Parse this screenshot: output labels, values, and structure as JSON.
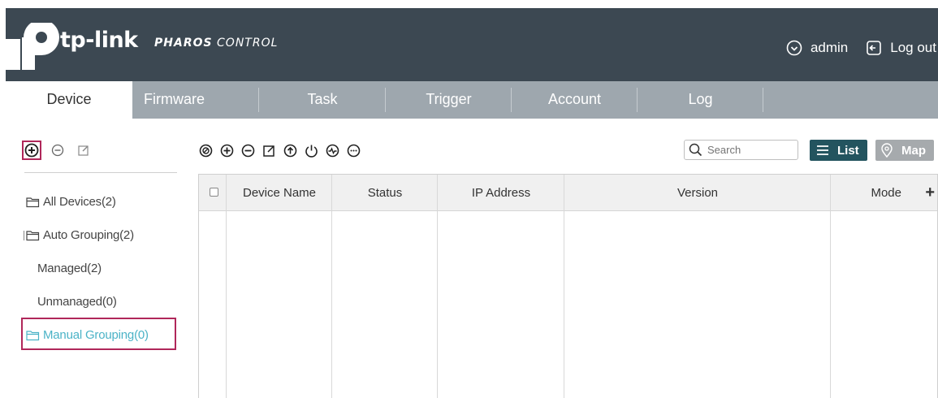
{
  "header": {
    "brand": "tp-link",
    "product_bold": "PHAROS",
    "product_light": "CONTROL",
    "user": "admin",
    "logout": "Log out",
    "colors": {
      "bar": "#3c4852",
      "tabs": "#9ea7ae",
      "accent": "#4bb3c7",
      "highlight": "#b0275a",
      "list_button": "#23545f"
    }
  },
  "tabs": [
    {
      "label": "Device",
      "active": true
    },
    {
      "label": "Firmware"
    },
    {
      "label": "Task"
    },
    {
      "label": "Trigger"
    },
    {
      "label": "Account"
    },
    {
      "label": "Log"
    }
  ],
  "left_tools": {
    "icons": [
      "add-group-icon",
      "remove-group-icon",
      "edit-group-icon"
    ]
  },
  "tree": {
    "all_devices": "All Devices(2)",
    "auto_grouping": "Auto Grouping(2)",
    "managed": "Managed(2)",
    "unmanaged": "Unmanaged(0)",
    "manual_grouping": "Manual Grouping(0)"
  },
  "toolbar": {
    "icons": [
      "adopt-icon",
      "add-icon",
      "remove-icon",
      "edit-icon",
      "upgrade-icon",
      "power-icon",
      "monitor-icon",
      "more-icon"
    ]
  },
  "search": {
    "placeholder": "Search"
  },
  "views": {
    "list": "List",
    "map": "Map"
  },
  "table": {
    "columns": [
      "Device Name",
      "Status",
      "IP Address",
      "Version",
      "Mode"
    ],
    "rows": []
  }
}
